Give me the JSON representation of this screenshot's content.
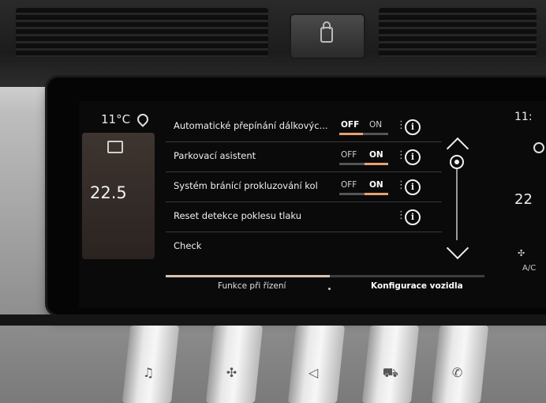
{
  "climate": {
    "outside_temp": "11°C",
    "cabin_temp": "22.5"
  },
  "settings": {
    "rows": [
      {
        "label": "Automatické přepínání dálkovýc...",
        "off": "OFF",
        "on": "ON",
        "state": "OFF"
      },
      {
        "label": "Parkovací asistent",
        "off": "OFF",
        "on": "ON",
        "state": "ON"
      },
      {
        "label": "Systém bránící prokluzování kol",
        "off": "OFF",
        "on": "ON",
        "state": "ON"
      },
      {
        "label": "Reset detekce poklesu tlaku"
      },
      {
        "label": "Check"
      }
    ],
    "info_symbol": "i",
    "more_symbol": "⋮"
  },
  "tabs": [
    {
      "label": "Funkce při řízení",
      "active": true
    },
    {
      "label": "Konfigurace vozidla",
      "active": false
    }
  ],
  "right_panel": {
    "time_partial": "11:",
    "temp_partial": "22",
    "ac_partial": "A/C"
  },
  "keys": [
    {
      "icon": "music-note-icon",
      "glyph": "♫"
    },
    {
      "icon": "fan-icon",
      "glyph": "✣"
    },
    {
      "icon": "navigation-icon",
      "glyph": "◁"
    },
    {
      "icon": "car-icon",
      "glyph": "⛟"
    },
    {
      "icon": "phone-icon",
      "glyph": "✆"
    }
  ],
  "colors": {
    "accent": "#e6a172",
    "text": "#f0f0f0",
    "screen_bg": "#0a0a0a"
  }
}
